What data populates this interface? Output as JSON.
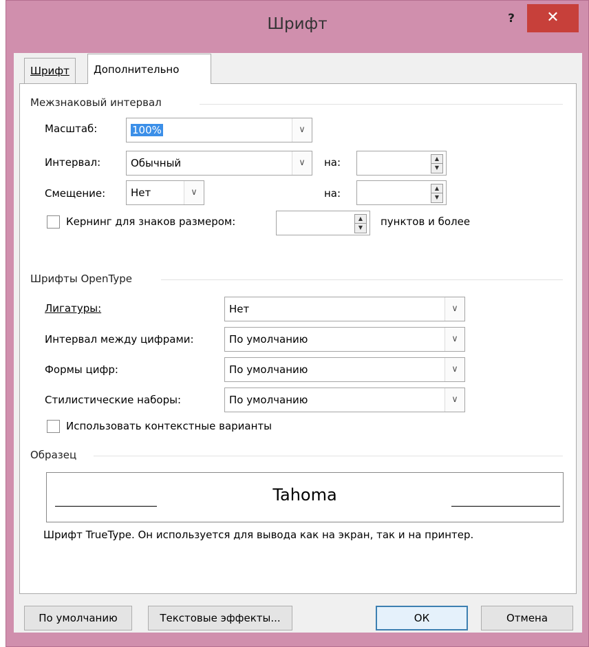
{
  "window": {
    "title": "Шрифт",
    "help_glyph": "?",
    "close_glyph": "✕"
  },
  "tabs": [
    {
      "label": "Шрифт"
    },
    {
      "label": "Дополнительно"
    }
  ],
  "character_spacing": {
    "section_title": "Межзнаковый интервал",
    "scale": {
      "label": "Масштаб:",
      "value": "100%"
    },
    "spacing": {
      "label": "Интервал:",
      "value": "Обычный",
      "by_label": "на:",
      "by_value": ""
    },
    "position": {
      "label": "Смещение:",
      "value": "Нет",
      "by_label": "на:",
      "by_value": ""
    },
    "kerning": {
      "label": "Кернинг для знаков размером:",
      "value": "",
      "suffix": "пунктов и более",
      "checked": false
    }
  },
  "opentype": {
    "section_title": "Шрифты OpenType",
    "ligatures": {
      "label": "Лигатуры:",
      "value": "Нет"
    },
    "number_spacing": {
      "label": "Интервал между цифрами:",
      "value": "По умолчанию"
    },
    "number_forms": {
      "label": "Формы цифр:",
      "value": "По умолчанию"
    },
    "stylistic_sets": {
      "label": "Стилистические наборы:",
      "value": "По умолчанию"
    },
    "contextual_alternates": {
      "label": "Использовать контекстные варианты",
      "checked": false
    }
  },
  "preview": {
    "section_title": "Образец",
    "font_name": "Tahoma",
    "note": "Шрифт TrueType. Он используется для вывода как на экран, так и на принтер."
  },
  "buttons": {
    "default": "По умолчанию",
    "text_effects": "Текстовые эффекты...",
    "ok": "ОК",
    "cancel": "Отмена"
  },
  "icons": {
    "dropdown": "chevron-down-icon",
    "spin": "spin-arrows-icon"
  }
}
